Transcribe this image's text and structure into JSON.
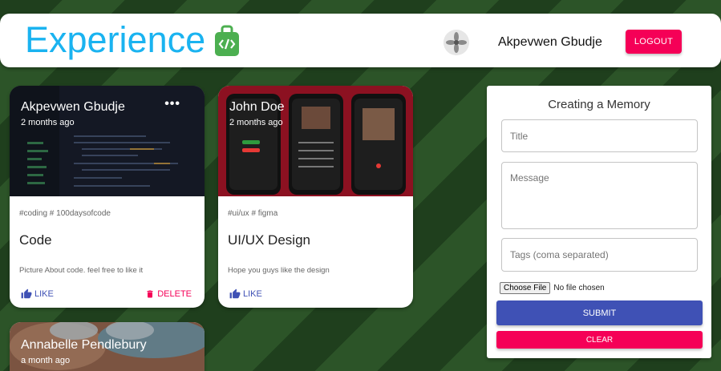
{
  "header": {
    "brand": "Experience",
    "user_name": "Akpevwen Gbudje",
    "logout_label": "LOGOUT"
  },
  "posts": [
    {
      "author": "Akpevwen Gbudje",
      "time": "2 months ago",
      "tags": "#coding # 100daysofcode",
      "title": "Code",
      "message": "Picture About code. feel free to like it",
      "like_label": "LIKE",
      "delete_label": "DELETE",
      "more": "•••"
    },
    {
      "author": "John Doe",
      "time": "2 months ago",
      "tags": "#ui/ux # figma",
      "title": "UI/UX Design",
      "message": "Hope you guys like the design",
      "like_label": "LIKE"
    },
    {
      "author": "Annabelle Pendlebury",
      "time": "a month ago"
    }
  ],
  "form": {
    "title": "Creating a Memory",
    "title_placeholder": "Title",
    "message_placeholder": "Message",
    "tags_placeholder": "Tags (coma separated)",
    "file_button": "Choose File",
    "file_status": "No file chosen",
    "submit_label": "SUBMIT",
    "clear_label": "CLEAR"
  },
  "colors": {
    "brand": "#1ab3f0",
    "primary": "#3f51b5",
    "secondary": "#f50057",
    "background_dark": "#1f3f1d",
    "background_light": "#2c5428"
  },
  "icons": [
    "code-bag-icon",
    "avatar-icon",
    "thumb-up-icon",
    "trash-icon",
    "more-horizontal-icon"
  ]
}
